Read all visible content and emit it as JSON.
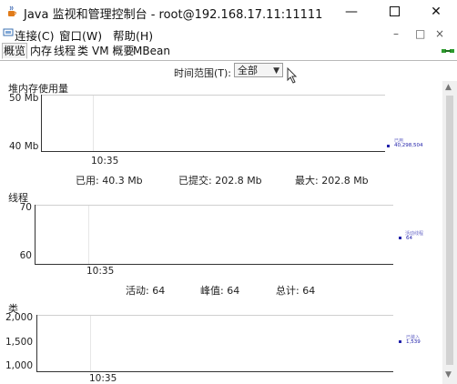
{
  "window": {
    "title": "Java 监视和管理控制台 - root@192.168.17.11:11111",
    "icons": [
      "java-icon",
      "minimize-icon",
      "maximize-icon",
      "close-icon"
    ]
  },
  "menubar": {
    "items": [
      "连接(C)",
      "窗口(W)",
      "帮助(H)"
    ],
    "right_glyphs": [
      "–",
      "□",
      "×"
    ]
  },
  "tabs": [
    "概览",
    "内存",
    "线程",
    "类",
    "VM 概要",
    "MBean"
  ],
  "time_range": {
    "label": "时间范围(T):",
    "value": "全部"
  },
  "heap": {
    "title": "堆内存使用量",
    "y_top": "50 Mb",
    "y_bottom": "40 Mb",
    "x_tick": "10:35",
    "legend_name": "已用",
    "legend_value": "40,298,504",
    "stats": [
      "已用:  40.3  Mb",
      "已提交:  202.8  Mb",
      "最大:  202.8  Mb"
    ]
  },
  "threads": {
    "title": "线程",
    "y_top": "70",
    "y_bottom": "60",
    "x_tick": "10:35",
    "legend_name": "活动线程",
    "legend_value": "64",
    "stats": [
      "活动:  64",
      "峰值:  64",
      "总计:  64"
    ]
  },
  "classes": {
    "title": "类",
    "y_top": "2,000",
    "y_mid": "1,500",
    "y_bottom": "1,000",
    "x_tick": "10:35",
    "legend_name": "已装入",
    "legend_value": "1,539"
  },
  "colors": {
    "series": "#2222aa",
    "legend_label": "#6b6bc8",
    "axis": "#333333"
  }
}
